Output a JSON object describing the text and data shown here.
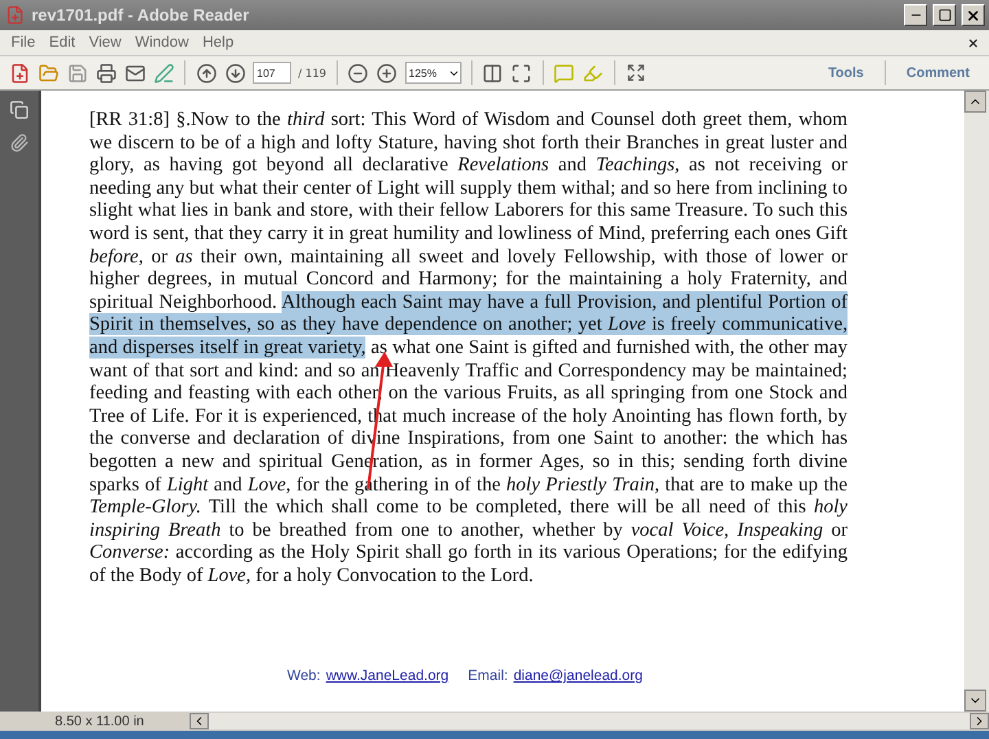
{
  "window": {
    "title": "rev1701.pdf - Adobe Reader"
  },
  "menu": [
    "File",
    "Edit",
    "View",
    "Window",
    "Help"
  ],
  "toolbar": {
    "page": "107",
    "page_count": "/ 119",
    "zoom": "125%",
    "tools": "Tools",
    "comment": "Comment"
  },
  "document": {
    "paragraph": {
      "before": "[RR 31:8] §.Now to the *third* sort: This Word of Wisdom and Counsel doth greet them, whom we discern to be of a high and lofty Stature, having shot forth their Branches in great luster and glory, as having got beyond all declarative *Revelations* and *Teachings*, as not receiving or needing any but what their center of Light will supply them withal; and so here from inclining to slight what lies in bank and store, with their fellow Laborers for this same Treasure. To such this word is sent, that they carry it in great humility and lowliness of Mind, preferring each ones Gift *before,* or *as* their own, maintaining all sweet and lovely Fellowship, with those of lower or higher degrees, in mutual Concord and Harmony; for the maintaining a holy Fraternity, and spiritual Neighborhood. ",
      "selected": "Although each Saint may have a full Provision, and plentiful Portion of Spirit in themselves, so as they have dependence on another; yet *Love* is freely communicative, and disperses itself in great variety,",
      "after": " as what one Saint is gifted and furnished with, the other may want of that sort and kind: and so an Heavenly Traffic and Correspondency may be maintained; feeding and feasting with each other, on the various Fruits, as all springing from one Stock and Tree of Life. For it is experienced, that much increase of the holy Anointing has flown forth, by the converse and declaration of divine Inspirations, from one Saint to another: the which has begotten a new and spiritual Generation, as in former Ages, so in this; sending forth divine sparks of *Light* and *Love*, for the gathering in of the *holy Priestly Train*, that are to make up the *Temple-Glory.* Till the which shall come to be completed, there will be all need of this *holy inspiring Breath* to be breathed from one to another, whether by *vocal Voice, Inspeaking* or *Converse:* according as the Holy Spirit shall go forth in its various Operations; for the edifying of the Body of *Love,* for a holy Convocation to the Lord."
    },
    "footer": {
      "web_label": "Web:",
      "web": "www.JaneLead.org",
      "email_label": "Email:",
      "email": "diane@janelead.org"
    }
  },
  "status": {
    "page_size": "8.50 x 11.00 in"
  }
}
